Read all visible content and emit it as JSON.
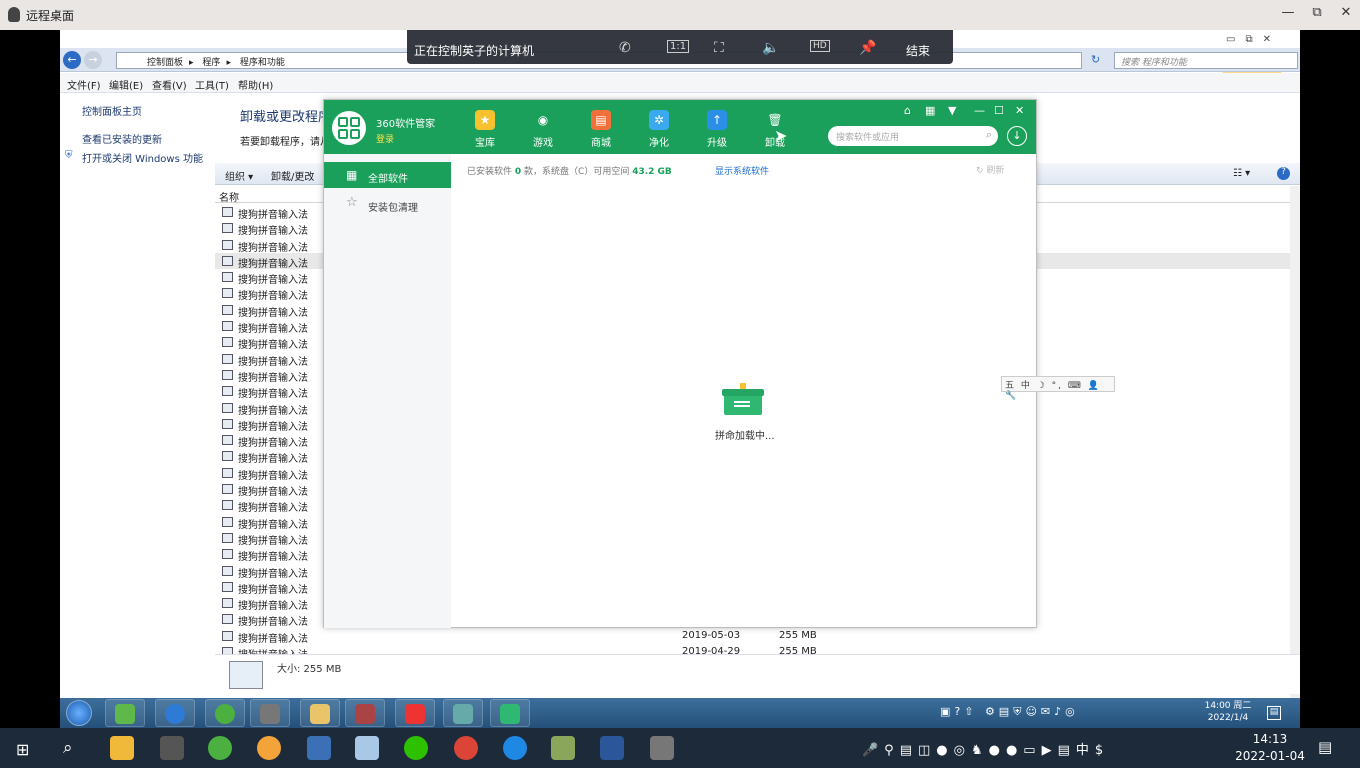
{
  "remote_window": {
    "title": "远程桌面",
    "minimize": "—",
    "restore": "⧉",
    "close": "✕"
  },
  "control_bar": {
    "text": "正在控制英子的计算机",
    "end": "结束",
    "icons": [
      "phone-icon",
      "ratio-1-1-icon",
      "fit-screen-icon",
      "volume-icon",
      "hd-icon",
      "pin-icon"
    ]
  },
  "explorer": {
    "breadcrumbs": [
      "控制面板",
      "程序",
      "程序和功能"
    ],
    "search_placeholder": "搜索 程序和功能",
    "menu": [
      "文件(F)",
      "编辑(E)",
      "查看(V)",
      "工具(T)",
      "帮助(H)"
    ],
    "left_links": [
      "控制面板主页",
      "查看已安装的更新",
      "打开或关闭 Windows 功能"
    ],
    "heading": "卸载或更改程序",
    "subheading": "若要卸载程序，请从",
    "toolbar": [
      "组织 ▾",
      "卸载/更改"
    ],
    "column_name": "名称",
    "program_name": "搜狗拼音输入法",
    "row_count": 28,
    "visible_rows_with_meta": [
      {
        "date": "2019-05-03",
        "size": "255 MB"
      },
      {
        "date": "2019-04-29",
        "size": "255 MB"
      }
    ],
    "details_size": "大小: 255 MB"
  },
  "app360": {
    "name": "360软件管家",
    "login": "登录",
    "nav": [
      {
        "label": "宝库",
        "icon": "star-icon",
        "color": "#f5c12e",
        "glyph": "★"
      },
      {
        "label": "游戏",
        "icon": "gamepad-icon",
        "color": "#ffffff",
        "glyph": "◉"
      },
      {
        "label": "商城",
        "icon": "shopping-bag-icon",
        "color": "#f2713a",
        "glyph": "▤"
      },
      {
        "label": "净化",
        "icon": "fan-icon",
        "color": "#3aa9f0",
        "glyph": "✲"
      },
      {
        "label": "升级",
        "icon": "upload-arrow-icon",
        "color": "#2b8fe8",
        "glyph": "↑"
      },
      {
        "label": "卸载",
        "icon": "trash-icon",
        "color": "#1aa05a",
        "glyph": "🗑"
      }
    ],
    "search_placeholder": "搜索软件或应用",
    "sidebar": [
      "全部软件",
      "安装包清理"
    ],
    "stats_prefix": "已安装软件",
    "stats_count": "0",
    "stats_mid": "款，系统盘（C）可用空间",
    "stats_space": "43.2 GB",
    "show_system": "显示系统软件",
    "refresh": "刷新",
    "loading": "拼命加载中..."
  },
  "ime_bar": "五 中 ☽ °, ⌨ 👤 🔧",
  "win7_taskbar": {
    "time": "14:00 周二",
    "date": "2022/1/4"
  },
  "win10_taskbar": {
    "time": "14:13",
    "date": "2022-01-04",
    "ime": "中"
  }
}
